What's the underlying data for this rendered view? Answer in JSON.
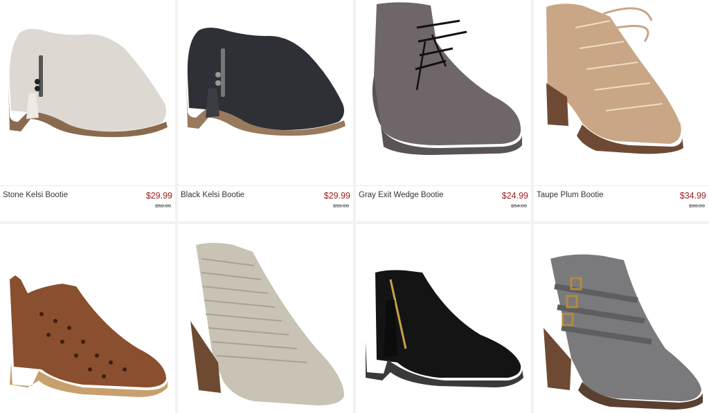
{
  "products": [
    {
      "name": "Stone Kelsi Bootie",
      "price": "$29.99",
      "original_price": "$50.00",
      "colors": {
        "body": "#ddd9d2",
        "sole": "#8a6a4e",
        "accent": "#eeeae4"
      }
    },
    {
      "name": "Black Kelsi Bootie",
      "price": "$29.99",
      "original_price": "$50.00",
      "colors": {
        "body": "#2e3036",
        "sole": "#9a7a5c",
        "accent": "#3b3d43"
      }
    },
    {
      "name": "Gray Exit Wedge Bootie",
      "price": "$24.99",
      "original_price": "$54.00",
      "colors": {
        "body": "#6e6668",
        "sole": "#5a5355",
        "accent": "#7d7577"
      }
    },
    {
      "name": "Taupe Plum Bootie",
      "price": "$34.99",
      "original_price": "$80.00",
      "colors": {
        "body": "#c9a685",
        "sole": "#6e4a35",
        "accent": "#d9b896"
      }
    },
    {
      "name": "",
      "price": "",
      "original_price": "",
      "colors": {
        "body": "#8a4f2e",
        "sole": "#c8a06e",
        "accent": "#a0643f"
      }
    },
    {
      "name": "",
      "price": "",
      "original_price": "",
      "colors": {
        "body": "#c9c3b5",
        "sole": "#6f4a32",
        "accent": "#dad5c9"
      }
    },
    {
      "name": "",
      "price": "",
      "original_price": "",
      "colors": {
        "body": "#141414",
        "sole": "#3a3a3a",
        "accent": "#c7a24a"
      }
    },
    {
      "name": "",
      "price": "",
      "original_price": "",
      "colors": {
        "body": "#7a7a7c",
        "sole": "#6e4a34",
        "accent": "#b38a3c"
      }
    }
  ]
}
